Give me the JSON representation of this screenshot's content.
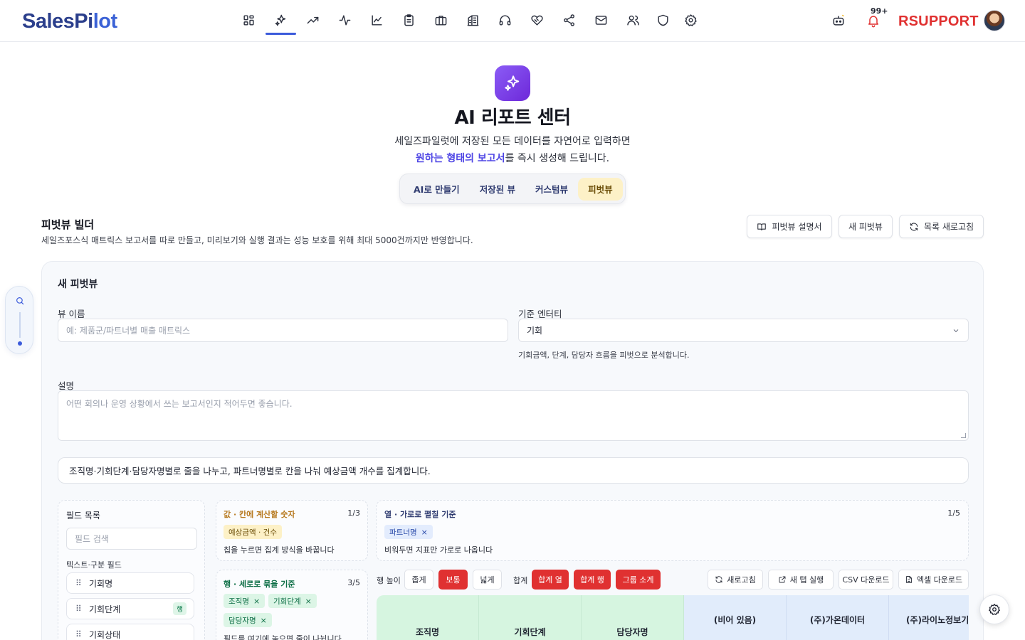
{
  "header": {
    "logo_part1": "SalesPi",
    "logo_part2": "lot",
    "nav_icons": [
      "dashboard-icon",
      "ai-sparkles-icon",
      "trend-icon",
      "activity-icon",
      "line-chart-icon",
      "clipboard-icon",
      "briefcase-icon",
      "building-icon",
      "headset-icon",
      "handshake-icon",
      "share-icon",
      "mail-icon",
      "users-icon",
      "shield-icon",
      "settings-icon"
    ],
    "active_nav": "ai-sparkles-icon",
    "notification_count": "99+",
    "brand": "RSUPPORT"
  },
  "hero": {
    "title": "AI 리포트 센터",
    "subtitle_line1": "세일즈파일럿에 저장된 모든 데이터를 자연어로 입력하면",
    "subtitle_highlight": "원하는 형태의 보고서",
    "subtitle_rest": "를 즉시 생성해 드립니다.",
    "tabs": [
      "AI로 만들기",
      "저장된 뷰",
      "커스텀뷰",
      "피벗뷰"
    ],
    "active_tab": "피벗뷰"
  },
  "builder": {
    "title": "피벗뷰 빌더",
    "description": "세일즈포스식 매트릭스 보고서를 따로 만들고, 미리보기와 실행 결과는 성능 보호를 위해 최대 5000건까지만 반영합니다.",
    "buttons": {
      "guide": "피벗뷰 설명서",
      "new": "새 피벗뷰",
      "refresh_list": "목록 새로고침"
    }
  },
  "form": {
    "card_title": "새 피벗뷰",
    "view_name_label": "뷰 이름",
    "view_name_placeholder": "예: 제품군/파트너별 매출 매트릭스",
    "entity_label": "기준 엔터티",
    "entity_value": "기회",
    "entity_hint": "기회금액, 단계, 담당자 흐름을 피벗으로 분석합니다.",
    "desc_label": "설명",
    "desc_placeholder": "어떤 회의나 운영 상황에서 쓰는 보고서인지 적어두면 좋습니다.",
    "summary": "조직명·기회단계·담당자명별로 줄을 나누고, 파트너명별로 칸을 나눠 예상금액 개수를 집계합니다."
  },
  "fields": {
    "title": "필드 목록",
    "search_placeholder": "필드 검색",
    "group_label": "텍스트·구분 필드",
    "items": [
      {
        "label": "기회명",
        "tag": ""
      },
      {
        "label": "기회단계",
        "tag": "행"
      },
      {
        "label": "기회상태",
        "tag": ""
      }
    ]
  },
  "zones": {
    "values": {
      "title": "값 · 칸에 계산할 숫자",
      "count": "1/3",
      "chips": [
        "예상금액 · 건수"
      ],
      "note": "칩을 누르면 집계 방식을 바꿉니다"
    },
    "columns": {
      "title": "열 · 가로로 펼칠 기준",
      "count": "1/5",
      "chips": [
        "파트너명"
      ],
      "note": "비워두면 지표만 가로로 나옵니다"
    },
    "rows": {
      "title": "행 · 세로로 묶을 기준",
      "count": "3/5",
      "chips": [
        "조직명",
        "기회단계",
        "담당자명"
      ],
      "note": "필드를 여기에 놓으면 줄이 나뉩니다"
    }
  },
  "toolbar": {
    "row_height_label": "행 높이",
    "row_heights": [
      "좁게",
      "보통",
      "넓게"
    ],
    "active_row_height": "보통",
    "totals_label": "합계",
    "totals": [
      "합계 열",
      "합계 행",
      "그룹 소계"
    ],
    "refresh": "새로고침",
    "new_tab": "새 탭 실행",
    "csv": "CSV 다운로드",
    "excel": "엑셀 다운로드"
  },
  "table": {
    "row_headers": [
      "조직명",
      "기회단계",
      "담당자명"
    ],
    "column_headers": [
      "(비어 있음)",
      "(주)가온데이터",
      "(주)라이노정보기"
    ]
  },
  "colors": {
    "accent": "#3b5bdb",
    "brand_red": "#e03131",
    "ai_purple": "#7c3aed",
    "row_header_green": "#d6f5e0",
    "col_header_blue": "#e1ecfb"
  }
}
